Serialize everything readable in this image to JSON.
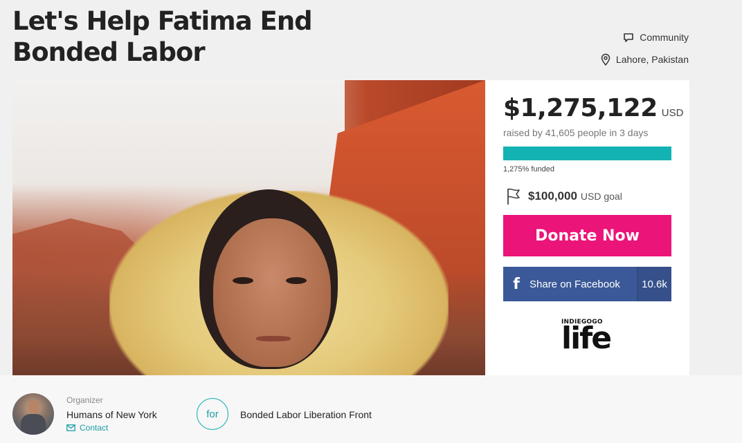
{
  "campaign": {
    "title": "Let's Help Fatima End Bonded Labor",
    "category": "Community",
    "location": "Lahore, Pakistan"
  },
  "funding": {
    "amount": "$1,275,122",
    "currency": "USD",
    "raised_text": "raised by 41,605 people in 3 days",
    "progress_fraction": 1.0,
    "funded_text": "1,275% funded",
    "goal_amount": "$100,000",
    "goal_label": "USD goal",
    "progress_color": "#14b3b3"
  },
  "actions": {
    "donate_label": "Donate Now",
    "donate_color": "#eb1478",
    "facebook_label": "Share on Facebook",
    "facebook_count": "10.6k",
    "facebook_color": "#3b5998"
  },
  "brand": {
    "logo_top": "INDIEGOGO",
    "logo_main": "life"
  },
  "organizer": {
    "label": "Organizer",
    "name": "Humans of New York",
    "contact_label": "Contact",
    "for_label": "for",
    "beneficiary": "Bonded Labor Liberation Front"
  },
  "icons": {
    "category": "speech-bubble-icon",
    "location": "map-pin-icon",
    "goal": "flag-icon",
    "facebook": "facebook-icon",
    "contact": "envelope-icon"
  }
}
